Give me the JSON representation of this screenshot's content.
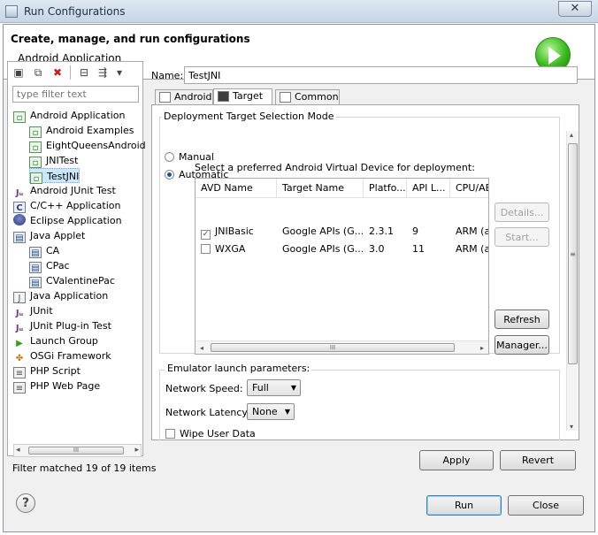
{
  "window": {
    "title": "Run Configurations",
    "close_glyph": "✕"
  },
  "header": {
    "title": "Create, manage, and run configurations",
    "subtitle": "Android Application",
    "badge_icon": "run-play-icon"
  },
  "left_toolbar": {
    "buttons": [
      {
        "name": "new-configuration-icon",
        "glyph": "▣"
      },
      {
        "name": "duplicate-icon",
        "glyph": "⧉"
      },
      {
        "name": "delete-icon",
        "glyph": "✖"
      },
      {
        "name": "collapse-all-icon",
        "glyph": "⊟"
      },
      {
        "name": "filter-icon",
        "glyph": "⇶"
      },
      {
        "name": "view-menu-icon",
        "glyph": "▾"
      }
    ]
  },
  "filter": {
    "placeholder": "type filter text"
  },
  "tree": [
    {
      "label": "Android Application",
      "level": 0,
      "icon": "app",
      "glyph": "▫"
    },
    {
      "label": "Android Examples",
      "level": 1,
      "icon": "app",
      "glyph": "▫"
    },
    {
      "label": "EightQueensAndroid",
      "level": 1,
      "icon": "app",
      "glyph": "▫"
    },
    {
      "label": "JNITest",
      "level": 1,
      "icon": "app",
      "glyph": "▫"
    },
    {
      "label": "TestJNI",
      "level": 1,
      "icon": "app",
      "glyph": "▫",
      "selected": true
    },
    {
      "label": "Android JUnit Test",
      "level": 0,
      "icon": "junit",
      "glyph": "Jᵤ"
    },
    {
      "label": "C/C++ Application",
      "level": 0,
      "icon": "c",
      "glyph": "C"
    },
    {
      "label": "Eclipse Application",
      "level": 0,
      "icon": "ecl",
      "glyph": ""
    },
    {
      "label": "Java Applet",
      "level": 0,
      "icon": "applet",
      "glyph": "▤"
    },
    {
      "label": "CA",
      "level": 1,
      "icon": "applet",
      "glyph": "▤"
    },
    {
      "label": "CPac",
      "level": 1,
      "icon": "applet",
      "glyph": "▤"
    },
    {
      "label": "CValentinePac",
      "level": 1,
      "icon": "applet",
      "glyph": "▤"
    },
    {
      "label": "Java Application",
      "level": 0,
      "icon": "java",
      "glyph": "J"
    },
    {
      "label": "JUnit",
      "level": 0,
      "icon": "junit",
      "glyph": "Jᵤ"
    },
    {
      "label": "JUnit Plug-in Test",
      "level": 0,
      "icon": "junit",
      "glyph": "Jᵤ"
    },
    {
      "label": "Launch Group",
      "level": 0,
      "icon": "group",
      "glyph": "▶"
    },
    {
      "label": "OSGi Framework",
      "level": 0,
      "icon": "osgi",
      "glyph": "✤"
    },
    {
      "label": "PHP Script",
      "level": 0,
      "icon": "php",
      "glyph": "≡"
    },
    {
      "label": "PHP Web Page",
      "level": 0,
      "icon": "php",
      "glyph": "≡"
    }
  ],
  "left_scroll": {
    "thumb_glyph": "III",
    "left_glyph": "◂",
    "right_glyph": "▸"
  },
  "filter_status": "Filter matched 19 of 19 items",
  "name": {
    "label": "Name:",
    "value": "TestJNI"
  },
  "tabs": [
    {
      "label": "Android",
      "active": false
    },
    {
      "label": "Target",
      "active": true
    },
    {
      "label": "Common",
      "active": false
    }
  ],
  "deployment": {
    "group_label": "Deployment Target Selection Mode",
    "manual_label": "Manual",
    "automatic_label": "Automatic",
    "selected_mode": "automatic",
    "avd_caption": "Select a preferred Android Virtual Device for deployment:"
  },
  "avd_table": {
    "columns": [
      "AVD Name",
      "Target Name",
      "Platfo...",
      "API L...",
      "CPU/ABI"
    ],
    "rows": [
      {
        "checked": true,
        "check_glyph": "✓",
        "cells": [
          "JNIBasic",
          "Google APIs (G...",
          "2.3.1",
          "9",
          "ARM (armeabi)"
        ]
      },
      {
        "checked": false,
        "check_glyph": "",
        "cells": [
          "WXGA",
          "Google APIs (G...",
          "3.0",
          "11",
          "ARM (armeabi)"
        ]
      }
    ],
    "scroll_thumb_glyph": "III",
    "scroll_left_glyph": "◂",
    "scroll_right_glyph": "▸"
  },
  "avd_buttons": {
    "details": "Details...",
    "start": "Start...",
    "refresh": "Refresh",
    "manager": "Manager..."
  },
  "emulator": {
    "group_label": "Emulator launch parameters:",
    "network_speed_label": "Network Speed:",
    "network_speed_value": "Full",
    "network_latency_label": "Network Latency:",
    "network_latency_value": "None",
    "wipe_label": "Wipe User Data",
    "dropdown_glyph": "▼"
  },
  "vscroll": {
    "up_glyph": "▴",
    "down_glyph": "▾",
    "thumb_glyph": "≡"
  },
  "actions": {
    "apply": "Apply",
    "revert": "Revert",
    "run": "Run",
    "close": "Close"
  },
  "help": {
    "glyph": "?"
  }
}
